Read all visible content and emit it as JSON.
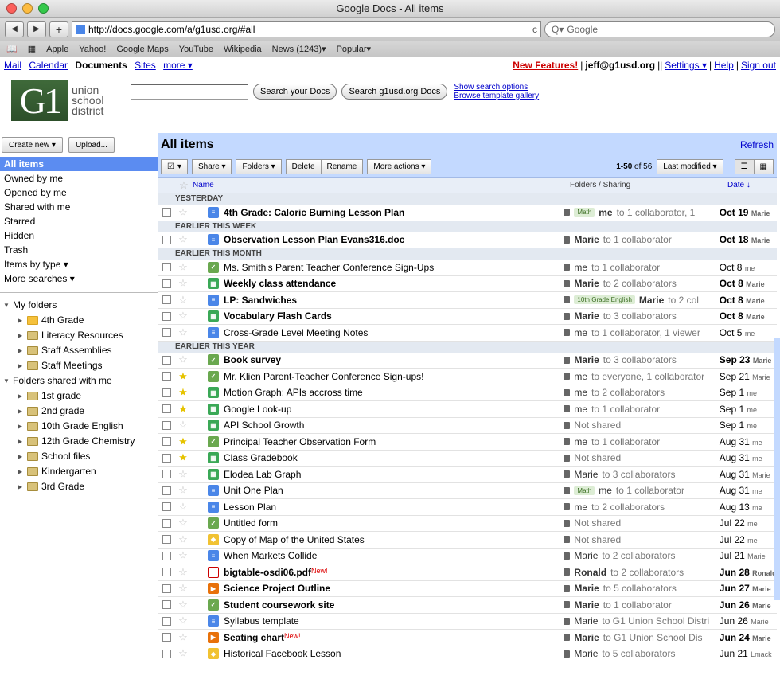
{
  "window": {
    "title": "Google Docs - All items"
  },
  "browser": {
    "url": "http://docs.google.com/a/g1usd.org/#all",
    "search_placeholder": "Google",
    "reload": "c",
    "bookmarks": [
      "Apple",
      "Yahoo!",
      "Google Maps",
      "YouTube",
      "Wikipedia",
      "News (1243)▾",
      "Popular▾"
    ]
  },
  "gbar": {
    "links": [
      "Mail",
      "Calendar",
      "Documents",
      "Sites",
      "more ▾"
    ],
    "new_features": "New Features!",
    "user": "jeff@g1usd.org",
    "settings": "Settings ▾",
    "help": "Help",
    "signout": "Sign out"
  },
  "logo": {
    "mark": "G1",
    "line1": "union",
    "line2": "school",
    "line3": "district"
  },
  "search": {
    "btn_docs": "Search your Docs",
    "btn_domain": "Search g1usd.org Docs",
    "opt1": "Show search options",
    "opt2": "Browse template gallery"
  },
  "sidebar": {
    "create": "Create new ▾",
    "upload": "Upload...",
    "items": [
      "All items",
      "Owned by me",
      "Opened by me",
      "Shared with me",
      "Starred",
      "Hidden",
      "Trash",
      "Items by type ▾",
      "More searches ▾"
    ],
    "my_folders": "My folders",
    "folders": [
      "4th Grade",
      "Literacy Resources",
      "Staff Assemblies",
      "Staff Meetings"
    ],
    "shared_with_me": "Folders shared with me",
    "shared_folders": [
      "1st grade",
      "2nd grade",
      "10th Grade English",
      "12th Grade Chemistry",
      "School files",
      "Kindergarten",
      "3rd Grade"
    ]
  },
  "content": {
    "title": "All items",
    "refresh": "Refresh",
    "actions": [
      "Share ▾",
      "Folders ▾",
      "Delete",
      "Rename",
      "More actions ▾"
    ],
    "pager": "1-50",
    "pager_of": "of 56",
    "sort": "Last modified ▾",
    "col_name": "Name",
    "col_folders": "Folders / Sharing",
    "col_date": "Date ↓"
  },
  "groups": [
    {
      "label": "YESTERDAY",
      "rows": [
        {
          "name": "4th Grade: Caloric Burning Lesson Plan",
          "icon": "doc",
          "bold": true,
          "tag": "Math",
          "who": "me",
          "rest": "to 1 collaborator, 1",
          "date": "Oct 19",
          "by": "Marie"
        }
      ]
    },
    {
      "label": "EARLIER THIS WEEK",
      "rows": [
        {
          "name": "Observation Lesson Plan Evans316.doc",
          "icon": "doc",
          "bold": true,
          "who": "Marie",
          "rest": "to 1 collaborator",
          "date": "Oct 18",
          "by": "Marie"
        }
      ]
    },
    {
      "label": "EARLIER THIS MONTH",
      "rows": [
        {
          "name": "Ms. Smith's Parent Teacher Conference Sign-Ups",
          "icon": "form",
          "who": "me",
          "rest": "to 1 collaborator",
          "date": "Oct 8",
          "by": "me"
        },
        {
          "name": "Weekly class attendance",
          "icon": "sheet",
          "bold": true,
          "who": "Marie",
          "rest": "to 2 collaborators",
          "date": "Oct 8",
          "by": "Marie"
        },
        {
          "name": "LP: Sandwiches",
          "icon": "doc",
          "bold": true,
          "tag": "10th Grade English",
          "who": "Marie",
          "rest": "to 2 col",
          "date": "Oct 8",
          "by": "Marie"
        },
        {
          "name": "Vocabulary Flash Cards",
          "icon": "sheet",
          "bold": true,
          "who": "Marie",
          "rest": "to 3 collaborators",
          "date": "Oct 8",
          "by": "Marie"
        },
        {
          "name": "Cross-Grade Level Meeting Notes",
          "icon": "doc",
          "who": "me",
          "rest": "to 1 collaborator, 1 viewer",
          "date": "Oct 5",
          "by": "me"
        }
      ]
    },
    {
      "label": "EARLIER THIS YEAR",
      "rows": [
        {
          "name": "Book survey",
          "icon": "form",
          "bold": true,
          "who": "Marie",
          "rest": "to 3 collaborators",
          "date": "Sep 23",
          "by": "Marie"
        },
        {
          "name": "Mr. Klien Parent-Teacher Conference Sign-ups!",
          "icon": "form",
          "star": true,
          "who": "me",
          "rest": "to everyone, 1 collaborator",
          "date": "Sep 21",
          "by": "Marie"
        },
        {
          "name": "Motion Graph: APIs accross time",
          "icon": "sheet",
          "star": true,
          "who": "me",
          "rest": "to 2 collaborators",
          "date": "Sep 1",
          "by": "me"
        },
        {
          "name": "Google Look-up",
          "icon": "sheet",
          "star": true,
          "who": "me",
          "rest": "to 1 collaborator",
          "date": "Sep 1",
          "by": "me"
        },
        {
          "name": "API School Growth",
          "icon": "sheet",
          "who": "",
          "rest": "Not shared",
          "date": "Sep 1",
          "by": "me"
        },
        {
          "name": "Principal Teacher Observation Form",
          "icon": "form",
          "star": true,
          "who": "me",
          "rest": "to 1 collaborator",
          "date": "Aug 31",
          "by": "me"
        },
        {
          "name": "Class Gradebook",
          "icon": "sheet",
          "star": true,
          "who": "",
          "rest": "Not shared",
          "date": "Aug 31",
          "by": "me"
        },
        {
          "name": "Elodea Lab Graph",
          "icon": "sheet",
          "who": "Marie",
          "rest": "to 3 collaborators",
          "date": "Aug 31",
          "by": "Marie"
        },
        {
          "name": "Unit One Plan",
          "icon": "doc",
          "tag": "Math",
          "who": "me",
          "rest": "to 1 collaborator",
          "date": "Aug 31",
          "by": "me"
        },
        {
          "name": "Lesson Plan",
          "icon": "doc",
          "who": "me",
          "rest": "to 2 collaborators",
          "date": "Aug 13",
          "by": "me"
        },
        {
          "name": "Untitled form",
          "icon": "form",
          "who": "",
          "rest": "Not shared",
          "date": "Jul 22",
          "by": "me"
        },
        {
          "name": "Copy of Map of the United States",
          "icon": "draw",
          "who": "",
          "rest": "Not shared",
          "date": "Jul 22",
          "by": "me"
        },
        {
          "name": "When Markets Collide",
          "icon": "doc",
          "who": "Marie",
          "rest": "to 2 collaborators",
          "date": "Jul 21",
          "by": "Marie"
        },
        {
          "name": "bigtable-osdi06.pdf",
          "icon": "pdf",
          "bold": true,
          "isnew": true,
          "who": "Ronald",
          "rest": "to 2 collaborators",
          "date": "Jun 28",
          "by": "Ronald"
        },
        {
          "name": "Science Project Outline",
          "icon": "ppt",
          "bold": true,
          "who": "Marie",
          "rest": "to 5 collaborators",
          "date": "Jun 27",
          "by": "Marie"
        },
        {
          "name": "Student coursework site",
          "icon": "form",
          "bold": true,
          "who": "Marie",
          "rest": "to 1 collaborator",
          "date": "Jun 26",
          "by": "Marie"
        },
        {
          "name": "Syllabus template",
          "icon": "doc",
          "who": "Marie",
          "rest": "to G1 Union School Distri",
          "date": "Jun 26",
          "by": "Marie"
        },
        {
          "name": "Seating chart",
          "icon": "ppt",
          "bold": true,
          "isnew": true,
          "who": "Marie",
          "rest": "to G1 Union School Dis",
          "date": "Jun 24",
          "by": "Marie"
        },
        {
          "name": "Historical Facebook Lesson",
          "icon": "draw",
          "who": "Marie",
          "rest": "to 5 collaborators",
          "date": "Jun 21",
          "by": "Lmack"
        }
      ]
    }
  ],
  "new_label": "New!"
}
